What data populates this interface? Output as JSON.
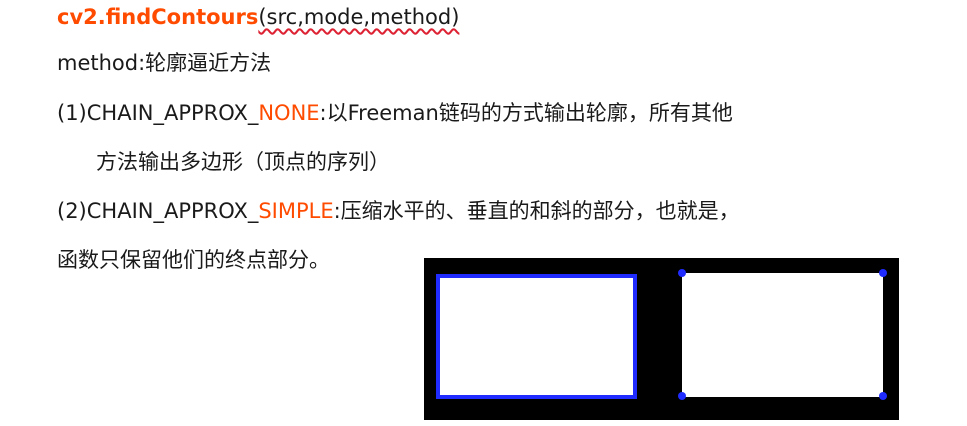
{
  "title": {
    "function": "cv2.findContours",
    "args": "(src,mode,method)"
  },
  "lines": {
    "method_desc": "method:轮廓逼近方法",
    "none_prefix": "(1)CHAIN_APPROX_",
    "none_keyword": "NONE",
    "none_desc": ":以Freeman链码的方式输出轮廓，所有其他",
    "none_desc_cont": "方法输出多边形（顶点的序列）",
    "simple_prefix": "(2)CHAIN_APPROX_",
    "simple_keyword": "SIMPLE",
    "simple_desc": ":压缩水平的、垂直的和斜的部分，也就是，",
    "simple_desc_cont": "函数只保留他们的终点部分。"
  },
  "colors": {
    "keyword": "#ff4b00",
    "contour": "#1f2bff",
    "figure_bg": "#000000"
  }
}
